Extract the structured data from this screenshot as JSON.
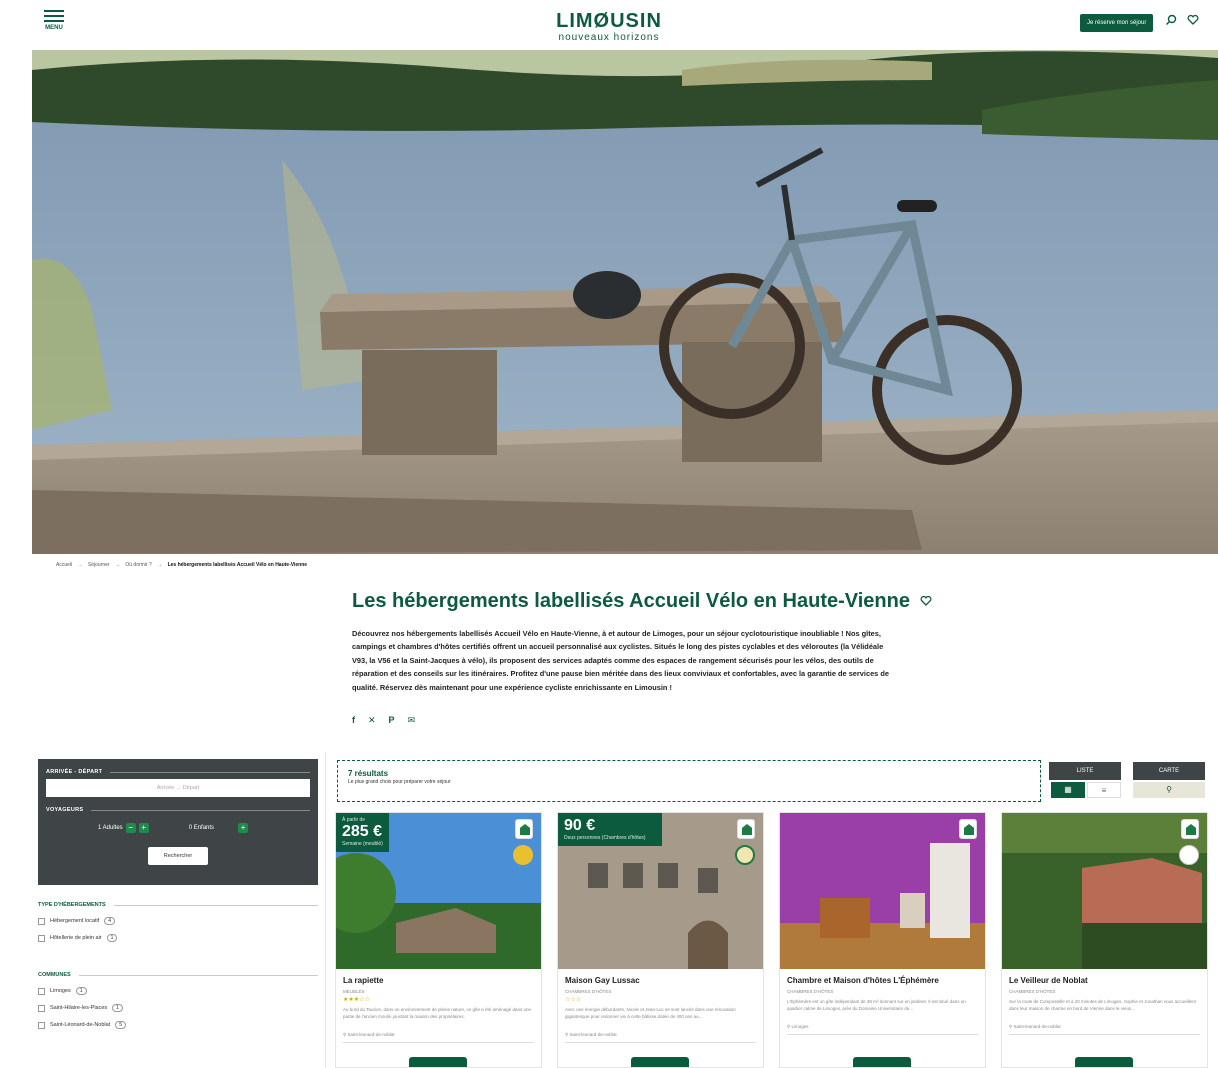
{
  "header": {
    "menu_label": "MENU",
    "logo_brand": "LIMØUSIN",
    "logo_tagline": "nouveaux horizons",
    "book_button": "Je réserve mon séjour",
    "search_icon": "search-icon",
    "wishlist_icon": "heart-icon"
  },
  "breadcrumb": {
    "items": [
      "Accueil",
      "Séjourner",
      "Où dormir ?",
      "Les hébergements labellisés Accueil Vélo en Haute-Vienne"
    ],
    "separator": "→"
  },
  "page": {
    "title": "Les hébergements labellisés Accueil Vélo en Haute-Vienne",
    "intro": "Découvrez nos hébergements labellisés Accueil Vélo en Haute-Vienne, à et autour de Limoges, pour un séjour cyclotouristique inoubliable ! Nos gîtes, campings et chambres d'hôtes certifiés offrent un accueil personnalisé aux cyclistes. Situés le long des pistes cyclables et des véloroutes (la Vélidéale V93, la V56 et la Saint-Jacques à vélo), ils proposent des services adaptés comme des espaces de rangement sécurisés pour les vélos, des outils de réparation et des conseils sur les itinéraires. Profitez d'une pause bien méritée dans des lieux conviviaux et confortables, avec la garantie de services de qualité. Réservez dès maintenant pour une expérience cycliste enrichissante en Limousin !"
  },
  "share": [
    "facebook-icon",
    "x-icon",
    "pinterest-icon",
    "email-icon"
  ],
  "filters": {
    "dates_label": "ARRIVÉE - DÉPART",
    "dates_placeholder": "Arrivée → Départ",
    "travellers_label": "VOYAGEURS",
    "adults": "1 Adultes",
    "children": "0 Enfants",
    "search_button": "Rechercher",
    "type_label": "TYPE D'HÉBERGEMENTS",
    "types": [
      {
        "label": "Hébergement locatif",
        "count": "4"
      },
      {
        "label": "Hôtellerie de plein air",
        "count": "1"
      }
    ],
    "communes_label": "COMMUNES",
    "communes": [
      {
        "label": "Limoges",
        "count": "1"
      },
      {
        "label": "Saint-Hilaire-les-Places",
        "count": "1"
      },
      {
        "label": "Saint-Léonard-de-Noblat",
        "count": "5"
      }
    ]
  },
  "results": {
    "count": "7 résultats",
    "subtitle": "Le plus grand choix pour préparer votre séjour"
  },
  "view": {
    "list_label": "LISTE",
    "map_label": "CARTE",
    "grid_icon": "grid-icon",
    "list_icon": "list-icon",
    "map_pin_icon": "map-pin-icon"
  },
  "cards": [
    {
      "price_from": "À partir de",
      "price": "285 €",
      "price_unit": "Semaine (meublé)",
      "title": "La rapiette",
      "type": "MEUBLÉS",
      "stars": "★★★☆☆",
      "desc": "Au bord du Taurion, dans un environnement de pleine nature, ce gîte a été aménagé dans une partie de l'ancien moulin jouxtant la maison des propriétaires.",
      "location": "Saint-leonard-de-noblat"
    },
    {
      "price_from": "",
      "price": "90 €",
      "price_unit": "Deux personnes (Chambres d'hôtes)",
      "title": "Maison Gay Lussac",
      "type": "CHAMBRES D'HÔTES",
      "stars": "☆☆☆",
      "desc": "Avec une énergie débordante, Nicole et Jean-Luc se sont lancés dans une rénovation gigantesque pour redonner vie à cette bâtisse datée de 400 ans au...",
      "location": "Saint-leonard-de-noblat"
    },
    {
      "price_from": "",
      "price": "",
      "price_unit": "",
      "title": "Chambre et Maison d'hôtes L'Éphémère",
      "type": "CHAMBRES D'HÔTES",
      "stars": "",
      "desc": "L'Éphémère est un gîte indépendant de 38 m² donnant sur un jardinet. Il est situé dans un quartier calme de Limoges, près du Domaine Universitaire de...",
      "location": "Limoges"
    },
    {
      "price_from": "",
      "price": "",
      "price_unit": "",
      "title": "Le Veilleur de Noblat",
      "type": "CHAMBRES D'HÔTES",
      "stars": "",
      "desc": "Sur la route de Compostelle et à 20 minutes de Limoges, Sophie et Jonathan vous accueillent dans leur maison de charme en bord de Vienne dans le vieux...",
      "location": "Saint-leonard-de-noblat"
    }
  ],
  "colors": {
    "brand": "#0c5b3e",
    "filters_bg": "#3f4447",
    "badge_green": "#1e8a4c"
  }
}
